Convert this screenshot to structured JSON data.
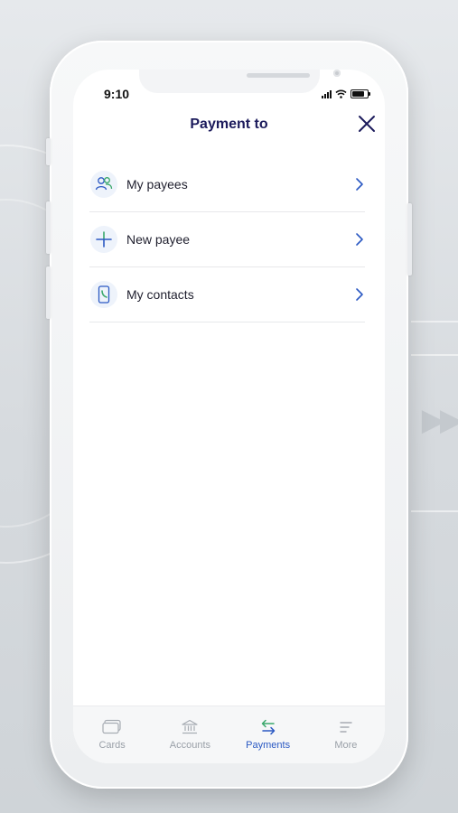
{
  "status_bar": {
    "time": "9:10"
  },
  "header": {
    "title": "Payment to"
  },
  "menu": {
    "items": [
      {
        "label": "My payees",
        "icon": "payees-icon"
      },
      {
        "label": "New payee",
        "icon": "plus-icon"
      },
      {
        "label": "My contacts",
        "icon": "contacts-icon"
      }
    ]
  },
  "tabbar": {
    "tabs": [
      {
        "label": "Cards",
        "icon": "cards-icon",
        "active": false
      },
      {
        "label": "Accounts",
        "icon": "bank-icon",
        "active": false
      },
      {
        "label": "Payments",
        "icon": "transfer-icon",
        "active": true
      },
      {
        "label": "More",
        "icon": "menu-icon",
        "active": false
      }
    ]
  },
  "colors": {
    "title": "#1c1b5c",
    "accent_blue": "#2b59c3",
    "accent_green": "#3aa86b",
    "inactive": "#9aa0a8"
  }
}
